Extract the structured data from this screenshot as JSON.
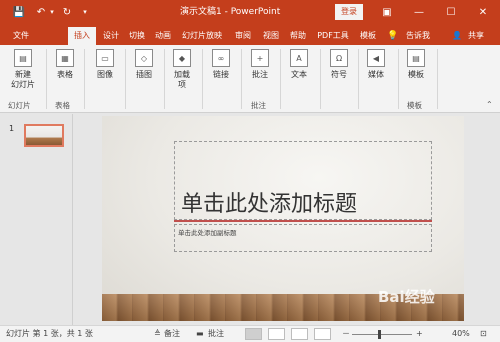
{
  "titlebar": {
    "title": "演示文稿1  -  PowerPoint",
    "login": "登录",
    "bg_color": "#c43e1c"
  },
  "quick_access": {
    "save_icon": "💾",
    "undo_icon": "↶",
    "undo_more_icon": "▾",
    "redo_icon": "↻",
    "customize_icon": "▾"
  },
  "window": {
    "ribbon_options_icon": "▣",
    "minimize_icon": "—",
    "maximize_icon": "☐",
    "close_icon": "✕"
  },
  "tabs": [
    {
      "label": "文件"
    },
    {
      "label": "插入"
    },
    {
      "label": "设计"
    },
    {
      "label": "切换"
    },
    {
      "label": "动画"
    },
    {
      "label": "幻灯片放映"
    },
    {
      "label": "审阅"
    },
    {
      "label": "视图"
    },
    {
      "label": "帮助"
    },
    {
      "label": "PDF工具"
    },
    {
      "label": "模板"
    },
    {
      "label": "告诉我"
    },
    {
      "label": "共享"
    }
  ],
  "tell_me_icon": "💡",
  "share_icon": "👤",
  "ribbon": {
    "new_slide": {
      "line1": "新建",
      "line2": "幻灯片"
    },
    "table": "表格",
    "image": "图像",
    "illustration": "插图",
    "addin": {
      "line1": "加载",
      "line2": "项"
    },
    "link": "链接",
    "comment": "批注",
    "text": "文本",
    "symbol": "符号",
    "media": "媒体",
    "template": "模板",
    "groups": {
      "slides": "幻灯片",
      "tables": "表格",
      "comments": "批注",
      "templates": "模板"
    }
  },
  "thumbnail": {
    "number": "1"
  },
  "slide": {
    "title_placeholder": "单击此处添加标题",
    "subtitle_placeholder": "单击此处添加副标题"
  },
  "statusbar": {
    "slide_info": "幻灯片 第 1 张，共 1 张",
    "notes": "备注",
    "comments": "批注",
    "zoom_minus": "－",
    "zoom_plus": "+",
    "zoom_value": "40%",
    "fit_icon": "⊡"
  },
  "watermark": "Bai经验"
}
